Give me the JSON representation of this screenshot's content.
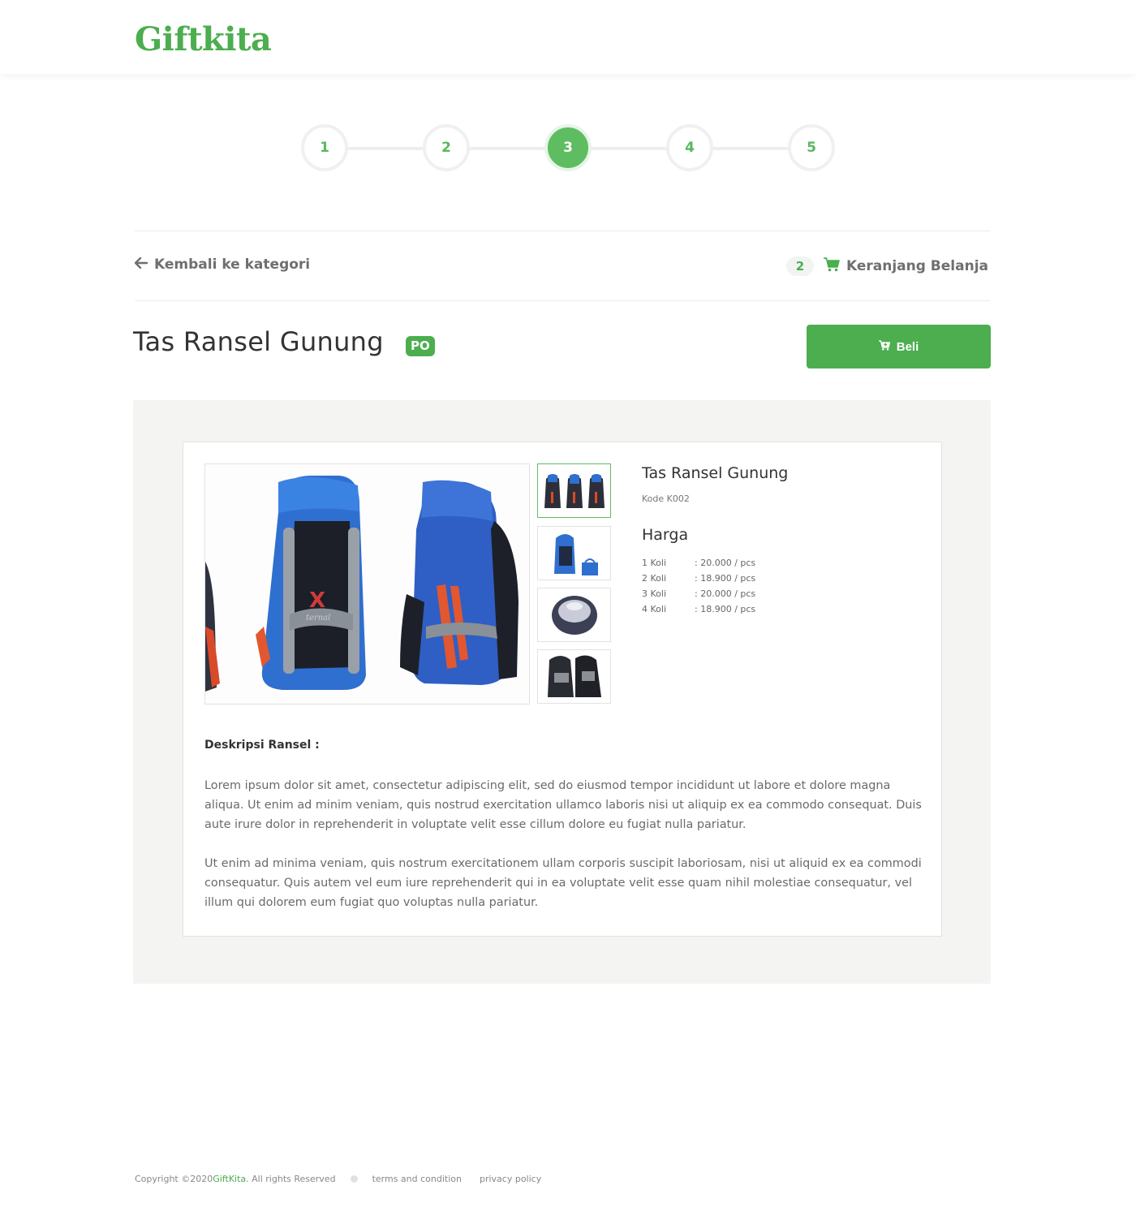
{
  "header": {
    "logo": "Giftkita"
  },
  "stepper": {
    "steps": [
      "1",
      "2",
      "3",
      "4",
      "5"
    ],
    "active_step": 3
  },
  "nav": {
    "back_label": "Kembali ke kategori",
    "cart_count": "2",
    "cart_label": "Keranjang Belanja"
  },
  "product": {
    "title": "Tas Ransel Gunung",
    "badge": "PO",
    "buy_label": "Beli",
    "name": "Tas Ransel Gunung",
    "code": "Kode K002",
    "price_heading": "Harga",
    "prices": [
      {
        "qty": "1 Koli",
        "price": ": 20.000 / pcs"
      },
      {
        "qty": "2 Koli",
        "price": ": 18.900 / pcs"
      },
      {
        "qty": "3 Koli",
        "price": ": 20.000 / pcs"
      },
      {
        "qty": "4 Koli",
        "price": ": 18.900 / pcs"
      }
    ],
    "description_title": "Deskripsi Ransel :",
    "description": [
      "Lorem ipsum dolor sit amet, consectetur adipiscing elit, sed do eiusmod tempor incididunt ut labore et dolore magna aliqua. Ut enim ad minim veniam, quis nostrud exercitation ullamco laboris nisi ut aliquip ex ea commodo consequat. Duis aute irure dolor in reprehenderit in voluptate velit esse cillum dolore eu fugiat nulla pariatur.",
      "Ut enim ad minima veniam, quis nostrum exercitationem ullam corporis suscipit laboriosam, nisi ut aliquid ex ea commodi consequatur. Quis autem vel eum iure reprehenderit qui in ea voluptate velit esse quam nihil molestiae consequatur, vel illum qui dolorem eum fugiat quo voluptas nulla pariatur."
    ],
    "main_image_text": "X",
    "main_image_subtext": "ternal"
  },
  "footer": {
    "copyright": "Copyright ©2020 ",
    "brand": "GiftKita",
    "rights": ". All rights Reserved",
    "terms": "terms and condition",
    "privacy": "privacy policy"
  },
  "colors": {
    "accent": "#4cae4f",
    "step_active": "#5fbd61",
    "backpack_blue": "#2f6fd0"
  }
}
